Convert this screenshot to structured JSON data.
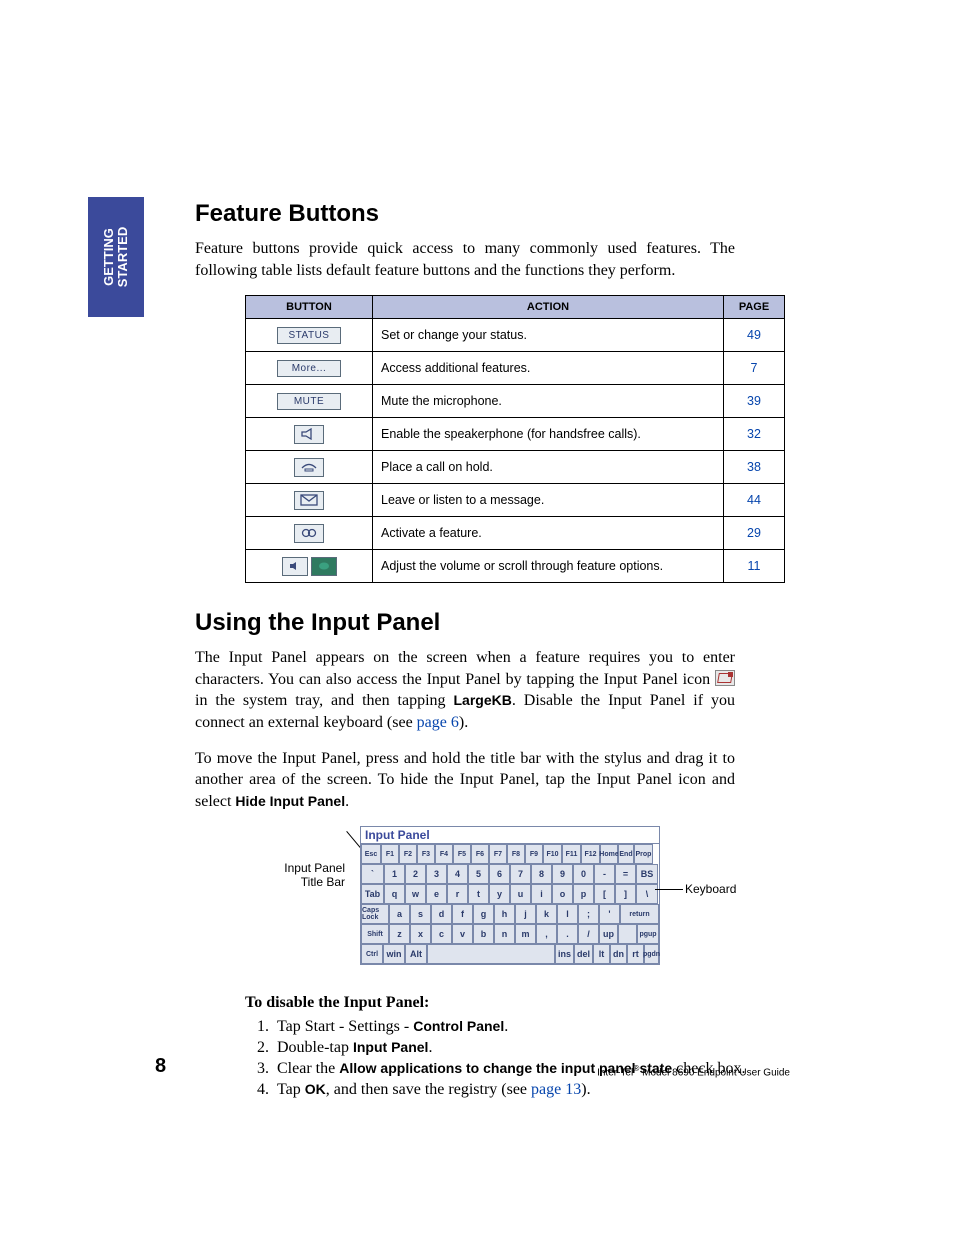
{
  "sideTab": {
    "line1": "GETTING",
    "line2": "STARTED"
  },
  "section1": {
    "title": "Feature Buttons",
    "intro": "Feature buttons provide quick access to many commonly used features. The following table lists default feature buttons and the functions they perform."
  },
  "table": {
    "headers": {
      "button": "BUTTON",
      "action": "ACTION",
      "page": "PAGE"
    },
    "rows": [
      {
        "type": "text",
        "label": "STATUS",
        "action": "Set or change your status.",
        "page": "49"
      },
      {
        "type": "text",
        "label": "More...",
        "action": "Access additional features.",
        "page": "7"
      },
      {
        "type": "text",
        "label": "MUTE",
        "action": "Mute the microphone.",
        "page": "39"
      },
      {
        "type": "icon",
        "icon": "speaker",
        "action": "Enable the speakerphone (for handsfree calls).",
        "page": "32"
      },
      {
        "type": "icon",
        "icon": "hold",
        "action": "Place a call on hold.",
        "page": "38"
      },
      {
        "type": "icon",
        "icon": "message",
        "action": "Leave or listen to a message.",
        "page": "44"
      },
      {
        "type": "icon",
        "icon": "feature",
        "action": "Activate a feature.",
        "page": "29"
      },
      {
        "type": "volume",
        "action": "Adjust the volume or scroll through feature options.",
        "page": "11"
      }
    ]
  },
  "section2": {
    "title": "Using the Input Panel",
    "p1a": "The Input Panel appears on the screen when a feature requires you to enter characters. You can also access the Input Panel by tapping the Input Panel icon ",
    "p1b": " in the system tray, and then tapping ",
    "p1_bold": "LargeKB",
    "p1c": ". Disable the Input Panel if you connect an external keyboard (see ",
    "p1_link": "page 6",
    "p1d": ").",
    "p2a": "To move the Input Panel, press and hold the title bar with the stylus and drag it to another area of the screen. To hide the Input Panel, tap the Input Panel icon and select ",
    "p2_bold": "Hide Input Panel",
    "p2b": "."
  },
  "figure": {
    "title": "Input Panel",
    "labelLeft1": "Input Panel",
    "labelLeft2": "Title Bar",
    "labelRight": "Keyboard",
    "rows": [
      [
        "Esc",
        "F1",
        "F2",
        "F3",
        "F4",
        "F5",
        "F6",
        "F7",
        "F8",
        "F9",
        "F10",
        "F11",
        "F12",
        "Home",
        "End",
        "Prop"
      ],
      [
        "`",
        "1",
        "2",
        "3",
        "4",
        "5",
        "6",
        "7",
        "8",
        "9",
        "0",
        "-",
        "=",
        "BS"
      ],
      [
        "Tab",
        "q",
        "w",
        "e",
        "r",
        "t",
        "y",
        "u",
        "i",
        "o",
        "p",
        "[",
        "]",
        "\\"
      ],
      [
        "Caps Lock",
        "a",
        "s",
        "d",
        "f",
        "g",
        "h",
        "j",
        "k",
        "l",
        ";",
        "'",
        "return"
      ],
      [
        "Shift",
        "z",
        "x",
        "c",
        "v",
        "b",
        "n",
        "m",
        ",",
        ".",
        "/",
        "up",
        "",
        "pgup"
      ],
      [
        "Ctrl",
        "win",
        "Alt",
        "",
        "ins",
        "del",
        "lt",
        "dn",
        "rt",
        "pgdn"
      ]
    ],
    "widths": [
      [
        20,
        18,
        18,
        18,
        18,
        18,
        18,
        18,
        18,
        18,
        19,
        19,
        19,
        18,
        16,
        19
      ],
      [
        23,
        21,
        21,
        21,
        21,
        21,
        21,
        21,
        21,
        21,
        21,
        21,
        21,
        22
      ],
      [
        23,
        21,
        21,
        21,
        21,
        21,
        21,
        21,
        21,
        21,
        21,
        21,
        21,
        22
      ],
      [
        28,
        21,
        21,
        21,
        21,
        21,
        21,
        21,
        21,
        21,
        21,
        21,
        39
      ],
      [
        28,
        21,
        21,
        21,
        21,
        21,
        21,
        21,
        21,
        21,
        21,
        19,
        19,
        22
      ],
      [
        22,
        22,
        22,
        128,
        19,
        19,
        17,
        17,
        17,
        15
      ]
    ]
  },
  "disable": {
    "heading": "To disable the Input Panel:",
    "steps": [
      {
        "a": "Tap Start - Settings - ",
        "b": "Control Panel",
        "c": "."
      },
      {
        "a": "Double-tap ",
        "b": "Input Panel",
        "c": "."
      },
      {
        "a": "Clear the ",
        "b": "Allow applications to change the input panel state",
        "c": " check box."
      },
      {
        "a": "Tap ",
        "b": "OK",
        "c": ", and then save the registry (see ",
        "link": "page 13",
        "d": ")."
      }
    ]
  },
  "footer": {
    "pageNum": "8",
    "textA": "Inter-Tel",
    "textB": " Model 8690 Endpoint User Guide"
  }
}
